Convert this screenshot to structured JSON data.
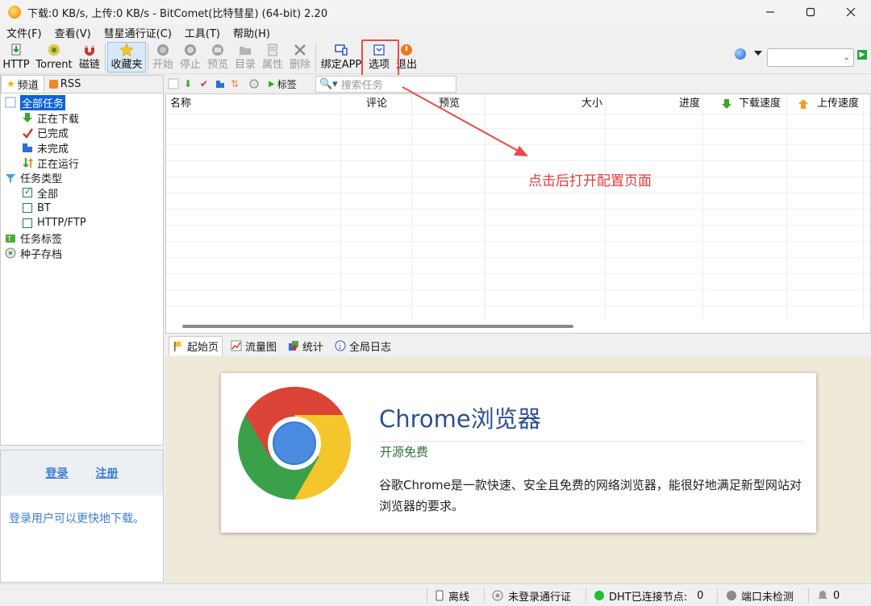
{
  "window": {
    "title": "下载:0 KB/s, 上传:0 KB/s - BitComet(比特彗星) (64-bit) 2.20",
    "controls": [
      "minimize-icon",
      "maximize-icon",
      "close-icon"
    ]
  },
  "menu": {
    "items": [
      "文件(F)",
      "查看(V)",
      "彗星通行证(C)",
      "工具(T)",
      "帮助(H)"
    ]
  },
  "toolbar": {
    "buttons": [
      {
        "label": "HTTP",
        "icon": "http-download-icon",
        "enabled": true
      },
      {
        "label": "Torrent",
        "icon": "torrent-icon",
        "enabled": true
      },
      {
        "label": "磁链",
        "icon": "magnet-icon",
        "enabled": true
      },
      {
        "label": "收藏夹",
        "icon": "star-icon",
        "enabled": true
      },
      {
        "label": "开始",
        "icon": "start-icon",
        "enabled": false
      },
      {
        "label": "停止",
        "icon": "stop-icon",
        "enabled": false
      },
      {
        "label": "预览",
        "icon": "preview-icon",
        "enabled": false
      },
      {
        "label": "目录",
        "icon": "folder-icon",
        "enabled": false
      },
      {
        "label": "属性",
        "icon": "properties-icon",
        "enabled": false
      },
      {
        "label": "删除",
        "icon": "delete-icon",
        "enabled": false
      },
      {
        "label": "绑定APP",
        "icon": "bind-app-icon",
        "enabled": true
      },
      {
        "label": "选项",
        "icon": "options-icon",
        "enabled": true
      },
      {
        "label": "退出",
        "icon": "exit-icon",
        "enabled": true
      }
    ],
    "search_value": ""
  },
  "left_panel": {
    "tabs": [
      "频道",
      "RSS"
    ],
    "tree": [
      {
        "label": "全部任务",
        "level": 0,
        "icon": "all-tasks-icon",
        "selected": true
      },
      {
        "label": "正在下载",
        "level": 1,
        "icon": "down-arrow-icon"
      },
      {
        "label": "已完成",
        "level": 1,
        "icon": "check-icon"
      },
      {
        "label": "未完成",
        "level": 1,
        "icon": "incomplete-icon"
      },
      {
        "label": "正在运行",
        "level": 1,
        "icon": "running-icon"
      },
      {
        "label": "任务类型",
        "level": 0,
        "icon": "filter-icon"
      },
      {
        "label": "全部",
        "level": 1,
        "icon": "checkbox-checked-icon"
      },
      {
        "label": "BT",
        "level": 1,
        "icon": "checkbox-icon"
      },
      {
        "label": "HTTP/FTP",
        "level": 1,
        "icon": "checkbox-icon"
      },
      {
        "label": "任务标签",
        "level": 0,
        "icon": "tag-icon"
      },
      {
        "label": "种子存档",
        "level": 0,
        "icon": "archive-icon"
      }
    ],
    "login": {
      "login_label": "登录",
      "register_label": "注册",
      "hint": "登录用户可以更快地下载。"
    }
  },
  "task_list": {
    "tag_label": "标签",
    "search_placeholder": "搜索任务",
    "columns": [
      "名称",
      "评论",
      "预览",
      "大小",
      "进度",
      "下载速度",
      "上传速度"
    ]
  },
  "bottom_tabs": [
    "起始页",
    "流量图",
    "统计",
    "全局日志"
  ],
  "start_page": {
    "title": "Chrome浏览器",
    "subtitle": "开源免费",
    "description": "谷歌Chrome是一款快速、安全且免费的网络浏览器，能很好地满足新型网站对浏览器的要求。"
  },
  "statusbar": {
    "offline": "离线",
    "not_logged": "未登录通行证",
    "dht": "DHT已连接节点:",
    "dht_count": "0",
    "port": "端口未检测",
    "alerts": "0"
  },
  "annotation": {
    "text": "点击后打开配置页面",
    "color": "#e23b3b"
  }
}
